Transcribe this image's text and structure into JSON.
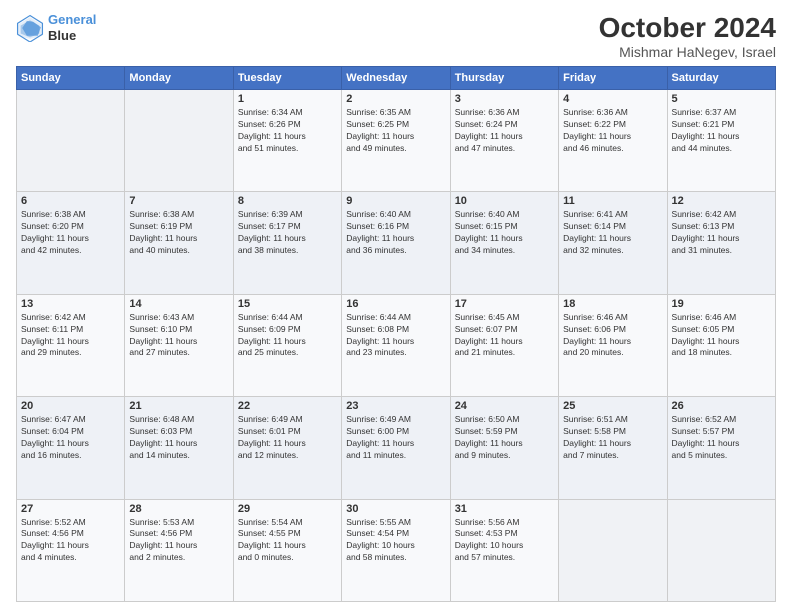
{
  "header": {
    "logo_line1": "General",
    "logo_line2": "Blue",
    "title": "October 2024",
    "subtitle": "Mishmar HaNegev, Israel"
  },
  "days_of_week": [
    "Sunday",
    "Monday",
    "Tuesday",
    "Wednesday",
    "Thursday",
    "Friday",
    "Saturday"
  ],
  "weeks": [
    [
      {
        "num": "",
        "info": ""
      },
      {
        "num": "",
        "info": ""
      },
      {
        "num": "1",
        "info": "Sunrise: 6:34 AM\nSunset: 6:26 PM\nDaylight: 11 hours\nand 51 minutes."
      },
      {
        "num": "2",
        "info": "Sunrise: 6:35 AM\nSunset: 6:25 PM\nDaylight: 11 hours\nand 49 minutes."
      },
      {
        "num": "3",
        "info": "Sunrise: 6:36 AM\nSunset: 6:24 PM\nDaylight: 11 hours\nand 47 minutes."
      },
      {
        "num": "4",
        "info": "Sunrise: 6:36 AM\nSunset: 6:22 PM\nDaylight: 11 hours\nand 46 minutes."
      },
      {
        "num": "5",
        "info": "Sunrise: 6:37 AM\nSunset: 6:21 PM\nDaylight: 11 hours\nand 44 minutes."
      }
    ],
    [
      {
        "num": "6",
        "info": "Sunrise: 6:38 AM\nSunset: 6:20 PM\nDaylight: 11 hours\nand 42 minutes."
      },
      {
        "num": "7",
        "info": "Sunrise: 6:38 AM\nSunset: 6:19 PM\nDaylight: 11 hours\nand 40 minutes."
      },
      {
        "num": "8",
        "info": "Sunrise: 6:39 AM\nSunset: 6:17 PM\nDaylight: 11 hours\nand 38 minutes."
      },
      {
        "num": "9",
        "info": "Sunrise: 6:40 AM\nSunset: 6:16 PM\nDaylight: 11 hours\nand 36 minutes."
      },
      {
        "num": "10",
        "info": "Sunrise: 6:40 AM\nSunset: 6:15 PM\nDaylight: 11 hours\nand 34 minutes."
      },
      {
        "num": "11",
        "info": "Sunrise: 6:41 AM\nSunset: 6:14 PM\nDaylight: 11 hours\nand 32 minutes."
      },
      {
        "num": "12",
        "info": "Sunrise: 6:42 AM\nSunset: 6:13 PM\nDaylight: 11 hours\nand 31 minutes."
      }
    ],
    [
      {
        "num": "13",
        "info": "Sunrise: 6:42 AM\nSunset: 6:11 PM\nDaylight: 11 hours\nand 29 minutes."
      },
      {
        "num": "14",
        "info": "Sunrise: 6:43 AM\nSunset: 6:10 PM\nDaylight: 11 hours\nand 27 minutes."
      },
      {
        "num": "15",
        "info": "Sunrise: 6:44 AM\nSunset: 6:09 PM\nDaylight: 11 hours\nand 25 minutes."
      },
      {
        "num": "16",
        "info": "Sunrise: 6:44 AM\nSunset: 6:08 PM\nDaylight: 11 hours\nand 23 minutes."
      },
      {
        "num": "17",
        "info": "Sunrise: 6:45 AM\nSunset: 6:07 PM\nDaylight: 11 hours\nand 21 minutes."
      },
      {
        "num": "18",
        "info": "Sunrise: 6:46 AM\nSunset: 6:06 PM\nDaylight: 11 hours\nand 20 minutes."
      },
      {
        "num": "19",
        "info": "Sunrise: 6:46 AM\nSunset: 6:05 PM\nDaylight: 11 hours\nand 18 minutes."
      }
    ],
    [
      {
        "num": "20",
        "info": "Sunrise: 6:47 AM\nSunset: 6:04 PM\nDaylight: 11 hours\nand 16 minutes."
      },
      {
        "num": "21",
        "info": "Sunrise: 6:48 AM\nSunset: 6:03 PM\nDaylight: 11 hours\nand 14 minutes."
      },
      {
        "num": "22",
        "info": "Sunrise: 6:49 AM\nSunset: 6:01 PM\nDaylight: 11 hours\nand 12 minutes."
      },
      {
        "num": "23",
        "info": "Sunrise: 6:49 AM\nSunset: 6:00 PM\nDaylight: 11 hours\nand 11 minutes."
      },
      {
        "num": "24",
        "info": "Sunrise: 6:50 AM\nSunset: 5:59 PM\nDaylight: 11 hours\nand 9 minutes."
      },
      {
        "num": "25",
        "info": "Sunrise: 6:51 AM\nSunset: 5:58 PM\nDaylight: 11 hours\nand 7 minutes."
      },
      {
        "num": "26",
        "info": "Sunrise: 6:52 AM\nSunset: 5:57 PM\nDaylight: 11 hours\nand 5 minutes."
      }
    ],
    [
      {
        "num": "27",
        "info": "Sunrise: 5:52 AM\nSunset: 4:56 PM\nDaylight: 11 hours\nand 4 minutes."
      },
      {
        "num": "28",
        "info": "Sunrise: 5:53 AM\nSunset: 4:56 PM\nDaylight: 11 hours\nand 2 minutes."
      },
      {
        "num": "29",
        "info": "Sunrise: 5:54 AM\nSunset: 4:55 PM\nDaylight: 11 hours\nand 0 minutes."
      },
      {
        "num": "30",
        "info": "Sunrise: 5:55 AM\nSunset: 4:54 PM\nDaylight: 10 hours\nand 58 minutes."
      },
      {
        "num": "31",
        "info": "Sunrise: 5:56 AM\nSunset: 4:53 PM\nDaylight: 10 hours\nand 57 minutes."
      },
      {
        "num": "",
        "info": ""
      },
      {
        "num": "",
        "info": ""
      }
    ]
  ]
}
